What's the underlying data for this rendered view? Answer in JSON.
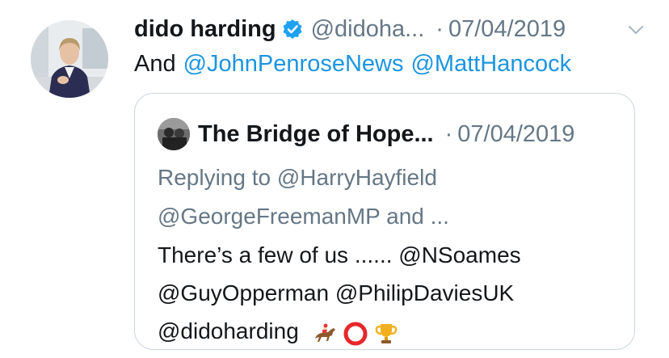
{
  "tweet": {
    "author_name": "dido harding",
    "author_handle": "@didoha...",
    "separator": "·",
    "date": "07/04/2019",
    "text_prefix": "And",
    "mentions": [
      "@JohnPenroseNews",
      "@MattHancock"
    ]
  },
  "quoted": {
    "author_name": "The Bridge of Hope...",
    "separator": "·",
    "date": "07/04/2019",
    "reply_line1": "Replying to @HarryHayfield",
    "reply_line2": "@GeorgeFreemanMP and ...",
    "text_line1": "There’s a few of us ...... @NSoames",
    "text_line2": "@GuyOpperman  @PhilipDaviesUK",
    "text_line3": "@didoharding"
  },
  "icons": {
    "verified": "verified-badge-icon",
    "chevron": "chevron-down-icon",
    "emojis": [
      "horse-racing-icon",
      "red-circle-icon",
      "trophy-icon"
    ]
  },
  "colors": {
    "link": "#1b95e0",
    "muted": "#657786",
    "verified": "#1da1f2"
  }
}
